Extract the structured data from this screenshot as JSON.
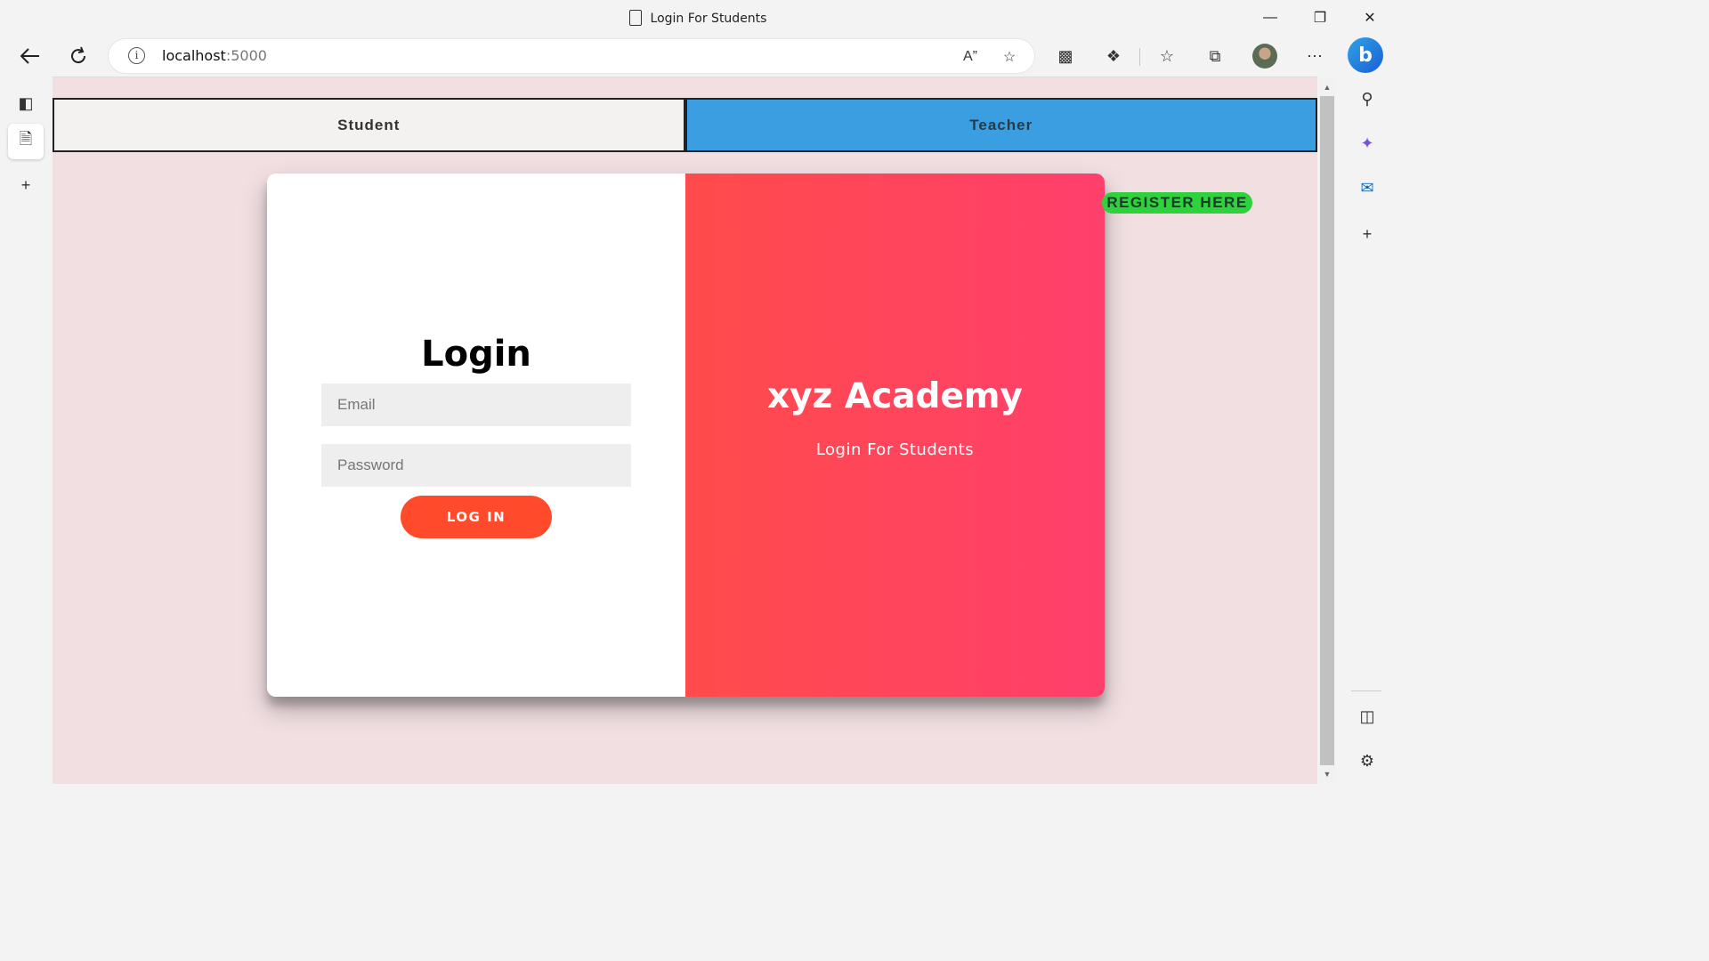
{
  "browser": {
    "tab_title": "Login For Students",
    "url_host": "localhost",
    "url_port": ":5000"
  },
  "page": {
    "tabs": [
      {
        "label": "Student"
      },
      {
        "label": "Teacher"
      }
    ],
    "login": {
      "heading": "Login",
      "email_placeholder": "Email",
      "password_placeholder": "Password",
      "button": "LOG IN"
    },
    "overlay": {
      "title": "xyz Academy",
      "subtitle": "Login For Students"
    },
    "register": "REGISTER HERE"
  },
  "colors": {
    "page_bg": "#f1dfe2",
    "teacher_tab": "#3b9ee0",
    "accent": "#ff4b2b",
    "register_bg": "#2ed23c"
  }
}
